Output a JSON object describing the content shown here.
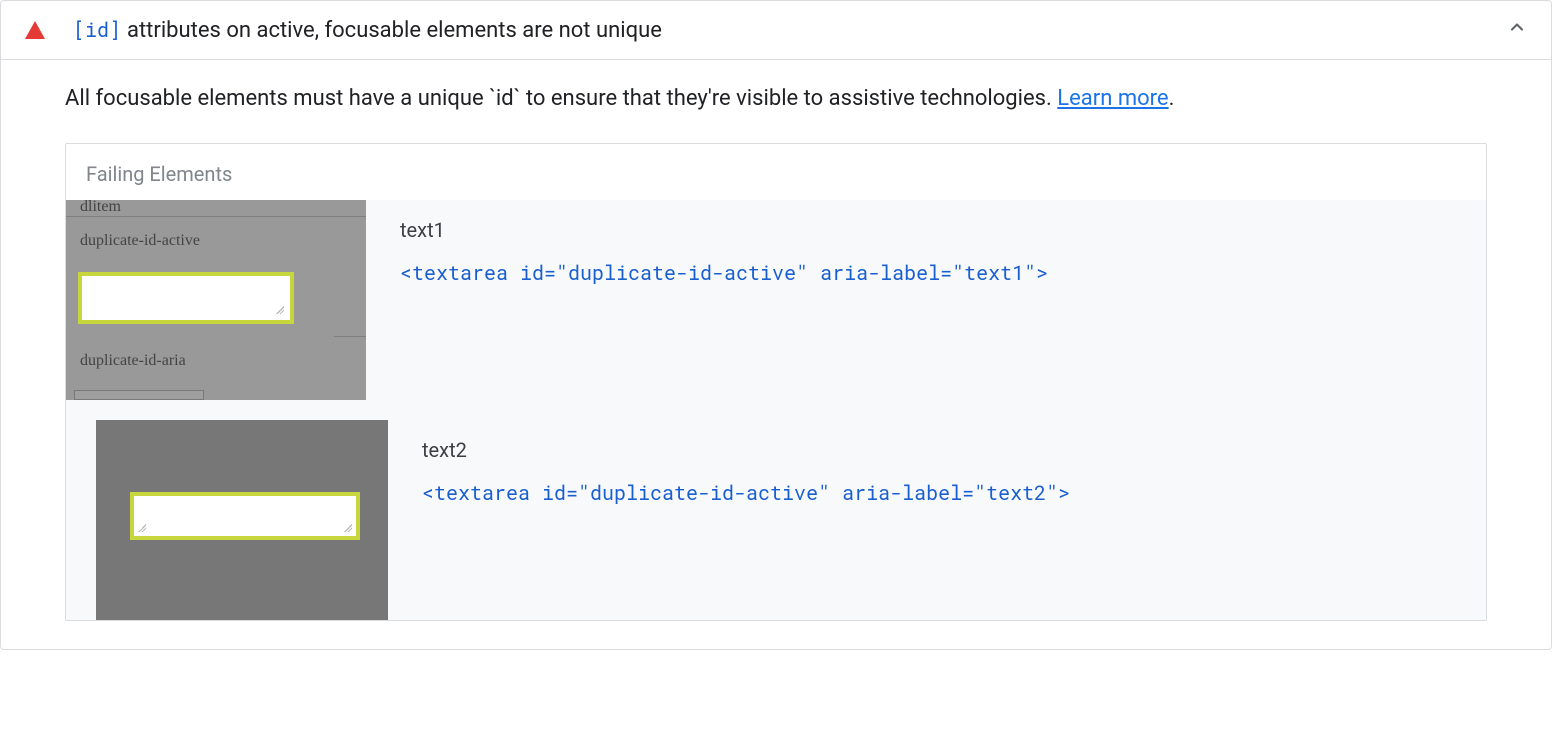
{
  "header": {
    "code_badge": "[id]",
    "title_text": "attributes on active, focusable elements are not unique"
  },
  "description": {
    "text": "All focusable elements must have a unique `id` to ensure that they're visible to assistive technologies. ",
    "learn_more": "Learn more",
    "trailing_period": "."
  },
  "failing": {
    "heading": "Failing Elements",
    "items": [
      {
        "label": "text1",
        "snippet": "<textarea id=\"duplicate-id-active\" aria-label=\"text1\">",
        "thumb_labels": {
          "top_cut": "dlitem",
          "mid": "duplicate-id-active",
          "bottom": "duplicate-id-aria"
        }
      },
      {
        "label": "text2",
        "snippet": "<textarea id=\"duplicate-id-active\" aria-label=\"text2\">"
      }
    ]
  }
}
